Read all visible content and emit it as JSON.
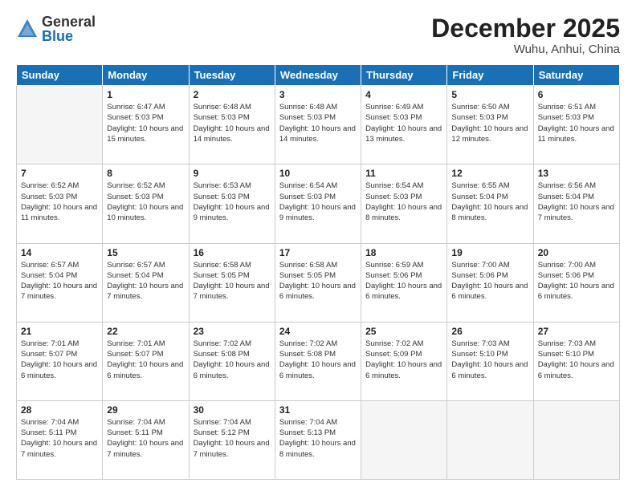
{
  "logo": {
    "general": "General",
    "blue": "Blue"
  },
  "title": "December 2025",
  "location": "Wuhu, Anhui, China",
  "days_of_week": [
    "Sunday",
    "Monday",
    "Tuesday",
    "Wednesday",
    "Thursday",
    "Friday",
    "Saturday"
  ],
  "weeks": [
    [
      {
        "day": "",
        "empty": true
      },
      {
        "day": "1",
        "sunrise": "Sunrise: 6:47 AM",
        "sunset": "Sunset: 5:03 PM",
        "daylight": "Daylight: 10 hours and 15 minutes."
      },
      {
        "day": "2",
        "sunrise": "Sunrise: 6:48 AM",
        "sunset": "Sunset: 5:03 PM",
        "daylight": "Daylight: 10 hours and 14 minutes."
      },
      {
        "day": "3",
        "sunrise": "Sunrise: 6:48 AM",
        "sunset": "Sunset: 5:03 PM",
        "daylight": "Daylight: 10 hours and 14 minutes."
      },
      {
        "day": "4",
        "sunrise": "Sunrise: 6:49 AM",
        "sunset": "Sunset: 5:03 PM",
        "daylight": "Daylight: 10 hours and 13 minutes."
      },
      {
        "day": "5",
        "sunrise": "Sunrise: 6:50 AM",
        "sunset": "Sunset: 5:03 PM",
        "daylight": "Daylight: 10 hours and 12 minutes."
      },
      {
        "day": "6",
        "sunrise": "Sunrise: 6:51 AM",
        "sunset": "Sunset: 5:03 PM",
        "daylight": "Daylight: 10 hours and 11 minutes."
      }
    ],
    [
      {
        "day": "7",
        "sunrise": "Sunrise: 6:52 AM",
        "sunset": "Sunset: 5:03 PM",
        "daylight": "Daylight: 10 hours and 11 minutes."
      },
      {
        "day": "8",
        "sunrise": "Sunrise: 6:52 AM",
        "sunset": "Sunset: 5:03 PM",
        "daylight": "Daylight: 10 hours and 10 minutes."
      },
      {
        "day": "9",
        "sunrise": "Sunrise: 6:53 AM",
        "sunset": "Sunset: 5:03 PM",
        "daylight": "Daylight: 10 hours and 9 minutes."
      },
      {
        "day": "10",
        "sunrise": "Sunrise: 6:54 AM",
        "sunset": "Sunset: 5:03 PM",
        "daylight": "Daylight: 10 hours and 9 minutes."
      },
      {
        "day": "11",
        "sunrise": "Sunrise: 6:54 AM",
        "sunset": "Sunset: 5:03 PM",
        "daylight": "Daylight: 10 hours and 8 minutes."
      },
      {
        "day": "12",
        "sunrise": "Sunrise: 6:55 AM",
        "sunset": "Sunset: 5:04 PM",
        "daylight": "Daylight: 10 hours and 8 minutes."
      },
      {
        "day": "13",
        "sunrise": "Sunrise: 6:56 AM",
        "sunset": "Sunset: 5:04 PM",
        "daylight": "Daylight: 10 hours and 7 minutes."
      }
    ],
    [
      {
        "day": "14",
        "sunrise": "Sunrise: 6:57 AM",
        "sunset": "Sunset: 5:04 PM",
        "daylight": "Daylight: 10 hours and 7 minutes."
      },
      {
        "day": "15",
        "sunrise": "Sunrise: 6:57 AM",
        "sunset": "Sunset: 5:04 PM",
        "daylight": "Daylight: 10 hours and 7 minutes."
      },
      {
        "day": "16",
        "sunrise": "Sunrise: 6:58 AM",
        "sunset": "Sunset: 5:05 PM",
        "daylight": "Daylight: 10 hours and 7 minutes."
      },
      {
        "day": "17",
        "sunrise": "Sunrise: 6:58 AM",
        "sunset": "Sunset: 5:05 PM",
        "daylight": "Daylight: 10 hours and 6 minutes."
      },
      {
        "day": "18",
        "sunrise": "Sunrise: 6:59 AM",
        "sunset": "Sunset: 5:06 PM",
        "daylight": "Daylight: 10 hours and 6 minutes."
      },
      {
        "day": "19",
        "sunrise": "Sunrise: 7:00 AM",
        "sunset": "Sunset: 5:06 PM",
        "daylight": "Daylight: 10 hours and 6 minutes."
      },
      {
        "day": "20",
        "sunrise": "Sunrise: 7:00 AM",
        "sunset": "Sunset: 5:06 PM",
        "daylight": "Daylight: 10 hours and 6 minutes."
      }
    ],
    [
      {
        "day": "21",
        "sunrise": "Sunrise: 7:01 AM",
        "sunset": "Sunset: 5:07 PM",
        "daylight": "Daylight: 10 hours and 6 minutes."
      },
      {
        "day": "22",
        "sunrise": "Sunrise: 7:01 AM",
        "sunset": "Sunset: 5:07 PM",
        "daylight": "Daylight: 10 hours and 6 minutes."
      },
      {
        "day": "23",
        "sunrise": "Sunrise: 7:02 AM",
        "sunset": "Sunset: 5:08 PM",
        "daylight": "Daylight: 10 hours and 6 minutes."
      },
      {
        "day": "24",
        "sunrise": "Sunrise: 7:02 AM",
        "sunset": "Sunset: 5:08 PM",
        "daylight": "Daylight: 10 hours and 6 minutes."
      },
      {
        "day": "25",
        "sunrise": "Sunrise: 7:02 AM",
        "sunset": "Sunset: 5:09 PM",
        "daylight": "Daylight: 10 hours and 6 minutes."
      },
      {
        "day": "26",
        "sunrise": "Sunrise: 7:03 AM",
        "sunset": "Sunset: 5:10 PM",
        "daylight": "Daylight: 10 hours and 6 minutes."
      },
      {
        "day": "27",
        "sunrise": "Sunrise: 7:03 AM",
        "sunset": "Sunset: 5:10 PM",
        "daylight": "Daylight: 10 hours and 6 minutes."
      }
    ],
    [
      {
        "day": "28",
        "sunrise": "Sunrise: 7:04 AM",
        "sunset": "Sunset: 5:11 PM",
        "daylight": "Daylight: 10 hours and 7 minutes."
      },
      {
        "day": "29",
        "sunrise": "Sunrise: 7:04 AM",
        "sunset": "Sunset: 5:11 PM",
        "daylight": "Daylight: 10 hours and 7 minutes."
      },
      {
        "day": "30",
        "sunrise": "Sunrise: 7:04 AM",
        "sunset": "Sunset: 5:12 PM",
        "daylight": "Daylight: 10 hours and 7 minutes."
      },
      {
        "day": "31",
        "sunrise": "Sunrise: 7:04 AM",
        "sunset": "Sunset: 5:13 PM",
        "daylight": "Daylight: 10 hours and 8 minutes."
      },
      {
        "day": "",
        "empty": true
      },
      {
        "day": "",
        "empty": true
      },
      {
        "day": "",
        "empty": true
      }
    ]
  ]
}
